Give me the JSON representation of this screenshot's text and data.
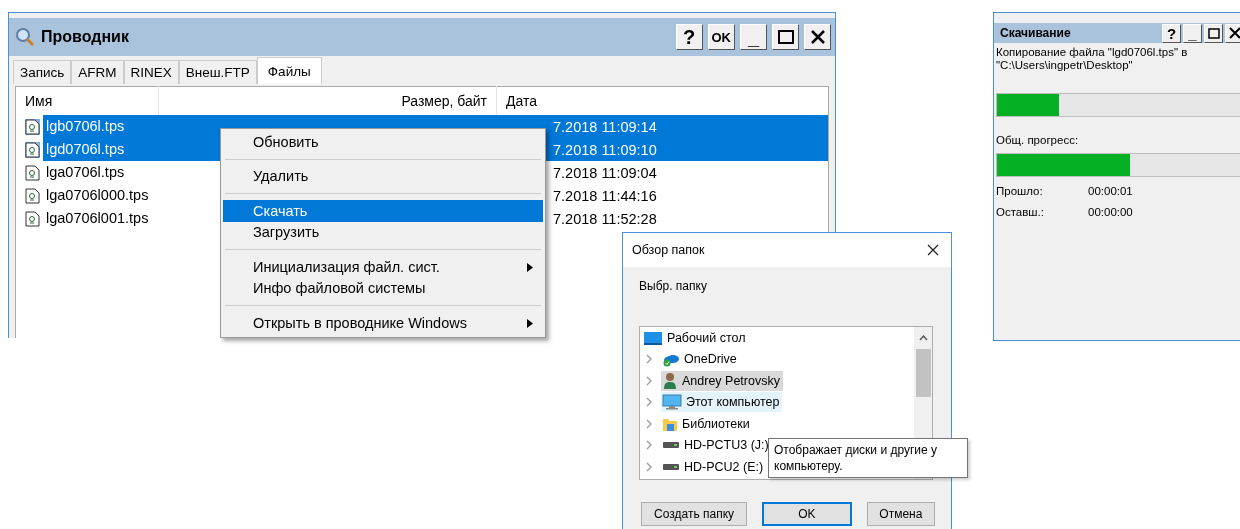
{
  "main_window": {
    "title": "Проводник",
    "buttons": [
      {
        "kind": "help",
        "label": "?"
      },
      {
        "kind": "ok",
        "label": "OK"
      },
      {
        "kind": "minimize",
        "label": "_"
      },
      {
        "kind": "maximize"
      },
      {
        "kind": "close"
      }
    ],
    "tabs": [
      {
        "label": "Запись",
        "selected": false
      },
      {
        "label": "AFRM",
        "selected": false
      },
      {
        "label": "RINEX",
        "selected": false
      },
      {
        "label": "Внеш.FTP",
        "selected": false
      },
      {
        "label": "Файлы",
        "selected": true
      }
    ],
    "table": {
      "columns": [
        "Имя",
        "Размер, байт",
        "Дата"
      ],
      "rows": [
        {
          "name": "lgb0706l.tps",
          "date": "7.2018 11:09:14",
          "selected": true
        },
        {
          "name": "lgd0706l.tps",
          "date": "7.2018 11:09:10",
          "selected": true
        },
        {
          "name": "lga0706l.tps",
          "date": "7.2018 11:09:04",
          "selected": false
        },
        {
          "name": "lga0706l000.tps",
          "date": "7.2018 11:44:16",
          "selected": false
        },
        {
          "name": "lga0706l001.tps",
          "date": "7.2018 11:52:28",
          "selected": false
        }
      ]
    },
    "context_menu": [
      {
        "label": "Обновить",
        "selected": false,
        "submenu": false,
        "separator_after": true
      },
      {
        "label": "Удалить",
        "selected": false,
        "submenu": false,
        "separator_after": true
      },
      {
        "label": "Скачать",
        "selected": true,
        "submenu": false,
        "separator_after": false
      },
      {
        "label": "Загрузить",
        "selected": false,
        "submenu": false,
        "separator_after": true
      },
      {
        "label": "Инициализация файл. сист.",
        "selected": false,
        "submenu": true,
        "separator_after": false
      },
      {
        "label": "Инфо файловой системы",
        "selected": false,
        "submenu": false,
        "separator_after": true
      },
      {
        "label": "Открыть в проводнике Windows",
        "selected": false,
        "submenu": true,
        "separator_after": false
      }
    ]
  },
  "browse_dialog": {
    "title": "Обзор папок",
    "prompt": "Выбр. папку",
    "tree": [
      {
        "label": "Рабочий стол",
        "kind": "desktop",
        "expandable": false,
        "selected": false,
        "hovered": false
      },
      {
        "label": "OneDrive",
        "kind": "cloud",
        "expandable": true,
        "selected": false,
        "hovered": false
      },
      {
        "label": "Andrey Petrovsky",
        "kind": "user",
        "expandable": true,
        "selected": true,
        "hovered": false
      },
      {
        "label": "Этот компьютер",
        "kind": "computer",
        "expandable": true,
        "selected": false,
        "hovered": true
      },
      {
        "label": "Библиотеки",
        "kind": "library",
        "expandable": true,
        "selected": false,
        "hovered": false
      },
      {
        "label": "HD-PCTU3 (J:)",
        "kind": "drive",
        "expandable": true,
        "selected": false,
        "hovered": false
      },
      {
        "label": "HD-PCU2 (E:)",
        "kind": "drive",
        "expandable": true,
        "selected": false,
        "hovered": false
      }
    ],
    "tooltip": [
      "Отображает диски и другие у",
      "компьютеру."
    ],
    "buttons": [
      {
        "label": "Создать папку",
        "default": false
      },
      {
        "label": "OK",
        "default": true
      },
      {
        "label": "Отмена",
        "default": false
      }
    ]
  },
  "progress_window": {
    "title": "Скачивание",
    "buttons": [
      {
        "kind": "help",
        "label": "?"
      },
      {
        "kind": "minimize",
        "label": "_"
      },
      {
        "kind": "maximize"
      },
      {
        "kind": "close"
      }
    ],
    "message": [
      "Копирование файла \"lgd0706l.tps\" в",
      "\"C:\\Users\\ingpetr\\Desktop\""
    ],
    "file_progress": {
      "level": 0.25
    },
    "total_label": "Общ. прогресс:",
    "total_progress": {
      "level": 0.54
    },
    "stats": [
      {
        "label": "Прошло:",
        "value": "00:00:01"
      },
      {
        "label": "Оставш.:",
        "value": "00:00:00"
      }
    ]
  }
}
